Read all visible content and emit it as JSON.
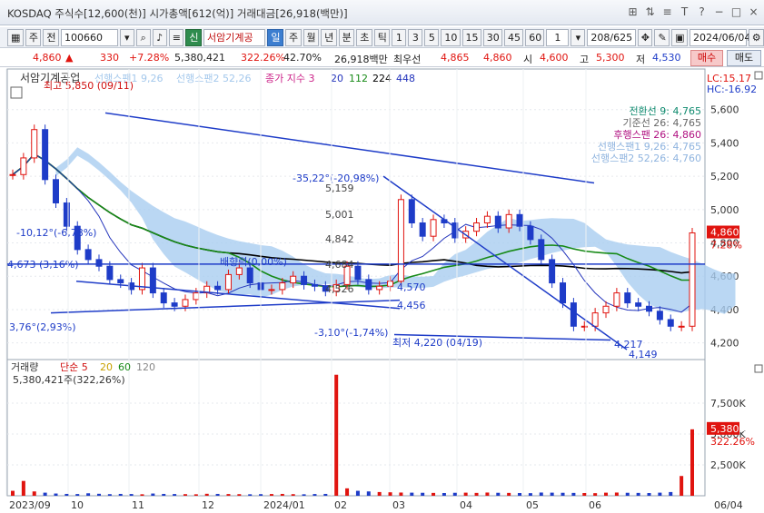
{
  "window": {
    "title": "KOSDAQ 주식수[12,600(천)] 시가총액[612(억)] 거래대금[26,918(백만)]",
    "controls": [
      "⊞",
      "⇅",
      "≡",
      "T",
      "?",
      "−",
      "□",
      "×"
    ]
  },
  "toolbar": {
    "type_label": "주",
    "prefix_label": "전",
    "stock_code": "100660",
    "credit_label": "신",
    "stock_name": "서암기계공",
    "periods": [
      "일",
      "주",
      "월",
      "년",
      "분",
      "초",
      "틱"
    ],
    "active_period": "일",
    "minute_steps": [
      "1",
      "3",
      "5",
      "10",
      "15",
      "30",
      "45",
      "60"
    ],
    "count_value": "1",
    "range": "208/625",
    "date": "2024/06/04"
  },
  "quote": {
    "price": "4,860",
    "change": "330",
    "change_pct": "+7.28%",
    "volume": "5,380,421",
    "volume_pct": "322.26%",
    "turnover_pct": "42.70%",
    "amount": "26,918백만",
    "best_ask_label": "최우선",
    "ask": "4,865",
    "bid": "4,860",
    "open_label": "시",
    "open": "4,600",
    "high_label": "고",
    "high": "5,300",
    "low_label": "저",
    "low": "4,530",
    "buy_label": "매수",
    "sell_label": "매도"
  },
  "chart_data": [
    {
      "type": "candlestick",
      "title": "서암기계공업",
      "legend": [
        "선행스팬1 9,26",
        "선행스팬2 52,26",
        "종가 지수 3",
        "20",
        "112",
        "224",
        "448"
      ],
      "legend_colors": [
        "#a4c8ec",
        "#a4c8ec",
        "#cc2288",
        "#2233bb",
        "#178a17",
        "#000000",
        "#2233bb"
      ],
      "ichimoku": [
        {
          "name": "전환선 9",
          "value": "4,765",
          "color": "#0e8a6e"
        },
        {
          "name": "기준선 26",
          "value": "4,765",
          "color": "#666666"
        },
        {
          "name": "후행스팬 26",
          "value": "4,860",
          "color": "#b01080"
        },
        {
          "name": "선행스팬1 9,26",
          "value": "4,765",
          "color": "#8fb4df"
        },
        {
          "name": "선행스팬2 52,26",
          "value": "4,760",
          "color": "#8fb4df"
        }
      ],
      "lc_label": "LC:15.17",
      "hc_label": "HC:-16.92",
      "y_axis": [
        5600,
        5400,
        5200,
        5000,
        4800,
        4600,
        4400,
        4200
      ],
      "ylim": [
        4100,
        5800
      ],
      "price_tag": "4,860",
      "price_tag_pct": "7.28%",
      "dates": [
        "2023/09",
        "10",
        "11",
        "12",
        "2024/01",
        "02",
        "03",
        "04",
        "05",
        "06"
      ],
      "right_date": "06/04",
      "closes": [
        5210,
        5310,
        5480,
        5180,
        5040,
        4900,
        4760,
        4700,
        4660,
        4580,
        4560,
        4520,
        4650,
        4500,
        4440,
        4420,
        4460,
        4500,
        4540,
        4520,
        4610,
        4650,
        4560,
        4520,
        4520,
        4560,
        4600,
        4550,
        4540,
        4510,
        4550,
        4660,
        4580,
        4520,
        4540,
        4570,
        5060,
        4920,
        4840,
        4940,
        4920,
        4830,
        4870,
        4920,
        4960,
        4890,
        4970,
        4900,
        4820,
        4700,
        4560,
        4440,
        4300,
        4300,
        4380,
        4420,
        4500,
        4440,
        4420,
        4390,
        4340,
        4300,
        4300,
        4860
      ],
      "lines": {
        "price_line_value": "4,673",
        "annotations": [
          {
            "label": "최고 5,850 (09/11)",
            "color": "#d01010"
          },
          {
            "label": "-10,12°(-6,78%)",
            "color": "#1e3cc8"
          },
          {
            "label": "4,673 (3,16%)",
            "color": "#1e3cc8"
          },
          {
            "label": "3,76°(2,93%)",
            "color": "#1e3cc8"
          },
          {
            "label": "배향력(0,00%)",
            "color": "#1e3cc8"
          },
          {
            "label": "-35,22°(-20,98%)",
            "color": "#1e3cc8"
          },
          {
            "label": "5,159",
            "color": "#444"
          },
          {
            "label": "5,001",
            "color": "#444"
          },
          {
            "label": "4,842",
            "color": "#444"
          },
          {
            "label": "4,684",
            "color": "#444"
          },
          {
            "label": "4,526",
            "color": "#444"
          },
          {
            "label": "4,570",
            "color": "#1e3cc8"
          },
          {
            "label": "4,456",
            "color": "#1e3cc8"
          },
          {
            "label": "-3,10°(-1,74%)",
            "color": "#1e3cc8"
          },
          {
            "label": "최저 4,220 (04/19)",
            "color": "#1e3cc8"
          },
          {
            "label": "4,217",
            "color": "#1e3cc8"
          },
          {
            "label": "4,149",
            "color": "#1e3cc8"
          }
        ]
      }
    },
    {
      "type": "bar",
      "title": "거래량",
      "legend": [
        "단순 5",
        "20",
        "60",
        "120"
      ],
      "legend_colors": [
        "#d01010",
        "#c8a000",
        "#178a17",
        "#888888"
      ],
      "info": "5,380,421주(322,26%)",
      "y_axis": [
        "7,500K",
        "5,000K",
        "2,500K"
      ],
      "ylim": [
        0,
        10000
      ],
      "tag": "5,380K",
      "tag_pct": "322.26%",
      "values": [
        400,
        1200,
        350,
        250,
        180,
        150,
        140,
        200,
        160,
        130,
        150,
        140,
        120,
        180,
        150,
        140,
        130,
        120,
        160,
        150,
        140,
        130,
        120,
        130,
        140,
        150,
        130,
        120,
        140,
        150,
        9800,
        600,
        400,
        350,
        300,
        280,
        260,
        250,
        240,
        230,
        220,
        240,
        250,
        230,
        260,
        240,
        230,
        220,
        210,
        260,
        250,
        240,
        230,
        220,
        210,
        250,
        260,
        240,
        230,
        220,
        250,
        300,
        1600,
        5380
      ]
    }
  ]
}
